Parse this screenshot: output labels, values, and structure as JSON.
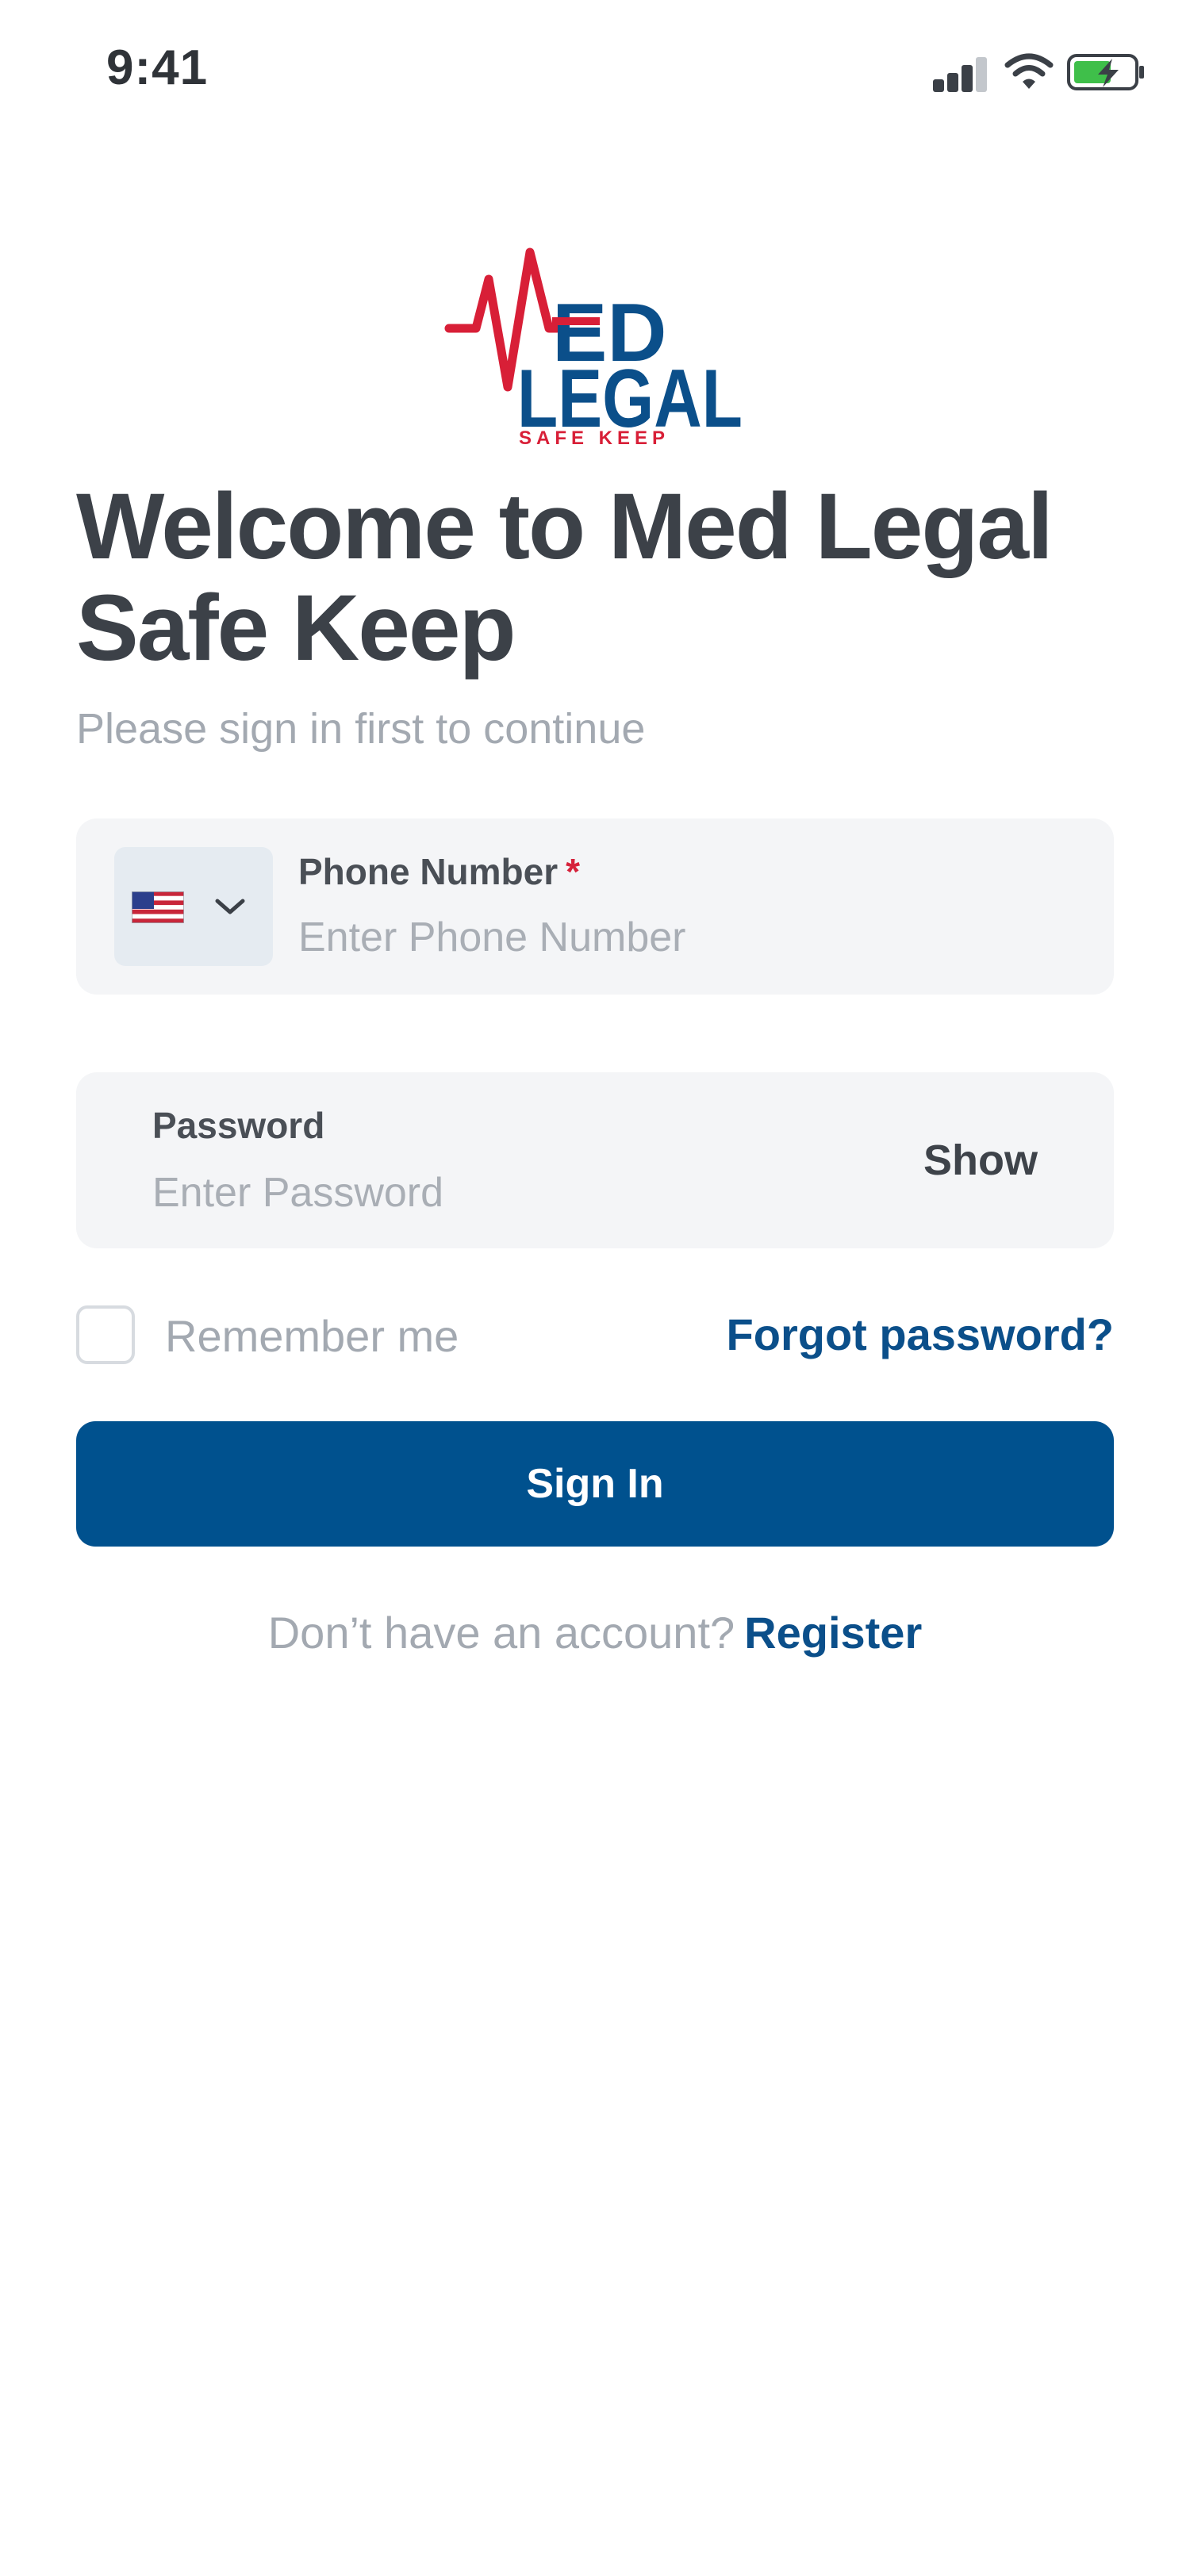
{
  "status_bar": {
    "time": "9:41",
    "icons": [
      "signal-icon",
      "wifi-icon",
      "battery-charging-icon"
    ]
  },
  "logo": {
    "line1": "ED",
    "line2": "LEGAL",
    "tagline": "SAFE KEEP",
    "colors": {
      "red": "#d81f37",
      "blue": "#0b4f8a"
    }
  },
  "header": {
    "title": "Welcome to Med Legal Safe Keep",
    "subtitle": "Please sign in first to continue"
  },
  "phone_field": {
    "label": "Phone Number",
    "required_mark": "*",
    "placeholder": "Enter Phone Number",
    "value": "",
    "country_flag_icon": "us-flag-icon"
  },
  "password_field": {
    "label": "Password",
    "placeholder": "Enter Password",
    "value": "",
    "toggle_label": "Show"
  },
  "remember": {
    "label": "Remember me",
    "checked": false
  },
  "forgot_password": "Forgot password?",
  "sign_in_label": "Sign In",
  "register": {
    "prompt": "Don’t have an account?",
    "link": "Register"
  },
  "colors": {
    "primary": "#00518e",
    "link": "#0b4f8a",
    "required": "#d6223b",
    "field_bg": "#f4f5f7"
  }
}
